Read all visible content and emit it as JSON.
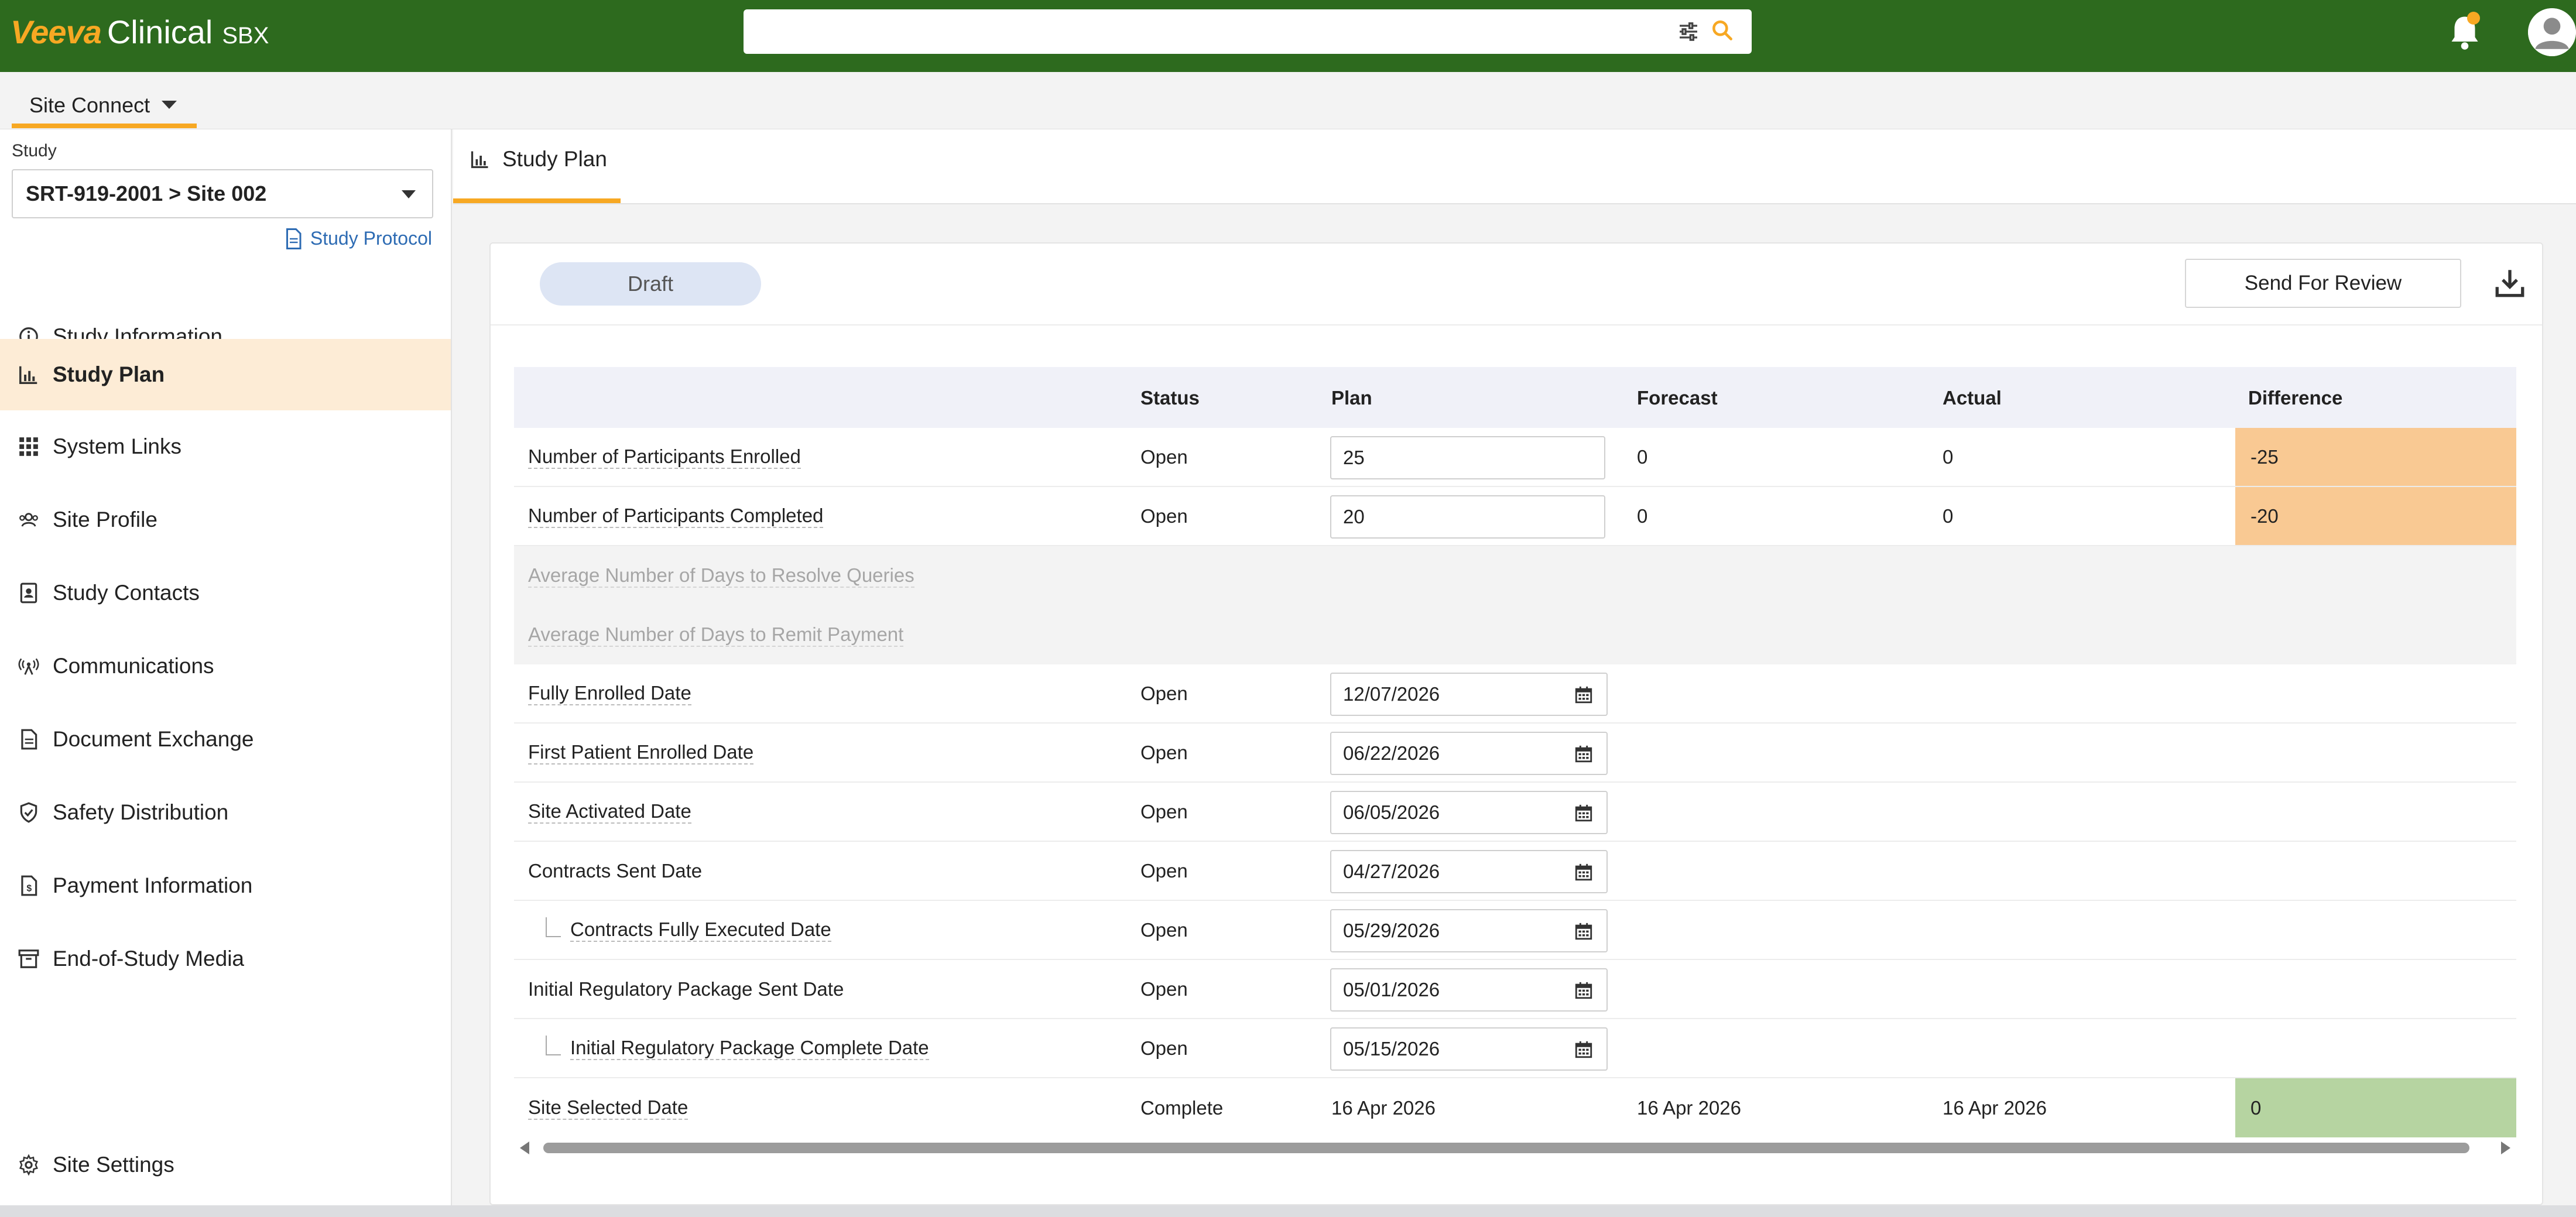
{
  "header": {
    "brand": "Veeva",
    "product": "Clinical",
    "environment": "SBX",
    "search": {
      "value": "",
      "placeholder": ""
    },
    "icons": {
      "filter": "sliders-icon",
      "search": "search-icon",
      "notifications": "bell-icon",
      "profile": "user-avatar-icon"
    },
    "colors": {
      "bar": "#2d6a1e",
      "accent": "#f7a823"
    }
  },
  "app_tab": {
    "label": "Site Connect"
  },
  "sidebar": {
    "study_label": "Study",
    "study_selected": "SRT-919-2001 > Site 002",
    "protocol_link": "Study Protocol",
    "items": [
      {
        "label": "Study Information",
        "icon": "info-icon"
      },
      {
        "label": "Study Plan",
        "icon": "bar-chart-icon",
        "active": true
      },
      {
        "label": "System Links",
        "icon": "grid-icon"
      },
      {
        "label": "Site Profile",
        "icon": "people-icon"
      },
      {
        "label": "Study Contacts",
        "icon": "contact-card-icon"
      },
      {
        "label": "Communications",
        "icon": "broadcast-icon"
      },
      {
        "label": "Document Exchange",
        "icon": "document-icon"
      },
      {
        "label": "Safety Distribution",
        "icon": "shield-check-icon"
      },
      {
        "label": "Payment Information",
        "icon": "payment-doc-icon"
      },
      {
        "label": "End-of-Study Media",
        "icon": "archive-box-icon"
      }
    ],
    "settings": {
      "label": "Site Settings",
      "icon": "gear-icon"
    }
  },
  "content_tab": {
    "label": "Study Plan",
    "icon": "bar-chart-icon"
  },
  "toolbar": {
    "status_pill": "Draft",
    "send_for_review": "Send For Review",
    "download_icon": "download-icon"
  },
  "table": {
    "columns": {
      "status": "Status",
      "plan": "Plan",
      "forecast": "Forecast",
      "actual": "Actual",
      "difference": "Difference"
    },
    "rows": [
      {
        "name": "Number of Participants Enrolled",
        "status": "Open",
        "plan": "25",
        "forecast": "0",
        "actual": "0",
        "difference": "-25"
      },
      {
        "name": "Number of Participants Completed",
        "status": "Open",
        "plan": "20",
        "forecast": "0",
        "actual": "0",
        "difference": "-20"
      },
      {
        "name": "Average Number of Days to Resolve Queries"
      },
      {
        "name": "Average Number of Days to Remit Payment"
      },
      {
        "name": "Fully Enrolled Date",
        "status": "Open",
        "plan": "12/07/2026"
      },
      {
        "name": "First Patient Enrolled Date",
        "status": "Open",
        "plan": "06/22/2026"
      },
      {
        "name": "Site Activated Date",
        "status": "Open",
        "plan": "06/05/2026"
      },
      {
        "name": "Contracts Sent Date",
        "status": "Open",
        "plan": "04/27/2026"
      },
      {
        "name": "Contracts Fully Executed Date",
        "status": "Open",
        "plan": "05/29/2026"
      },
      {
        "name": "Initial Regulatory Package Sent Date",
        "status": "Open",
        "plan": "05/01/2026"
      },
      {
        "name": "Initial Regulatory Package Complete Date",
        "status": "Open",
        "plan": "05/15/2026"
      },
      {
        "name": "Site Selected Date",
        "status": "Complete",
        "plan": "16 Apr 2026",
        "forecast": "16 Apr 2026",
        "actual": "16 Apr 2026",
        "difference": "0"
      }
    ]
  },
  "status_colors": {
    "negative_difference": "#f9c993",
    "zero_difference": "#b6d4a1"
  }
}
